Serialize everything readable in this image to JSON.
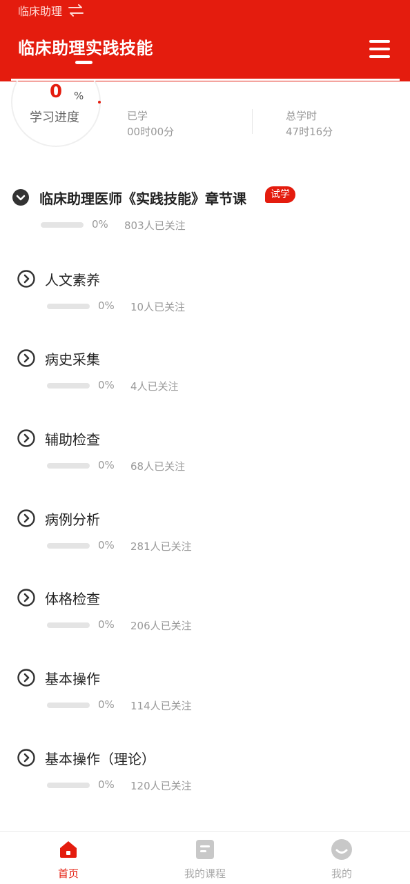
{
  "header": {
    "switcher_label": "临床助理",
    "title": "临床助理实践技能"
  },
  "summary": {
    "progress_value": "0",
    "progress_unit": "%",
    "progress_label": "学习进度",
    "studied_label": "已学",
    "studied_value": "00时00分",
    "total_label": "总学时",
    "total_value": "47时16分"
  },
  "chapters": [
    {
      "title": "临床助理医师《实践技能》章节课",
      "badge": "试学",
      "progress": 0,
      "percent": "0%",
      "followers": "803人已关注",
      "expanded": true
    },
    {
      "title": "人文素养",
      "progress": 0,
      "percent": "0%",
      "followers": "10人已关注",
      "expanded": false
    },
    {
      "title": "病史采集",
      "progress": 0,
      "percent": "0%",
      "followers": "4人已关注",
      "expanded": false
    },
    {
      "title": "辅助检查",
      "progress": 0,
      "percent": "0%",
      "followers": "68人已关注",
      "expanded": false
    },
    {
      "title": "病例分析",
      "progress": 0,
      "percent": "0%",
      "followers": "281人已关注",
      "expanded": false
    },
    {
      "title": "体格检查",
      "progress": 0,
      "percent": "0%",
      "followers": "206人已关注",
      "expanded": false
    },
    {
      "title": "基本操作",
      "progress": 0,
      "percent": "0%",
      "followers": "114人已关注",
      "expanded": false
    },
    {
      "title": "基本操作（理论）",
      "progress": 0,
      "percent": "0%",
      "followers": "120人已关注",
      "expanded": false
    }
  ],
  "tabbar": {
    "home": "首页",
    "my_courses": "我的课程",
    "mine": "我的"
  },
  "colors": {
    "brand": "#e41c0e",
    "icon_dark": "#333333",
    "inactive_icon": "#c8c8c8"
  }
}
